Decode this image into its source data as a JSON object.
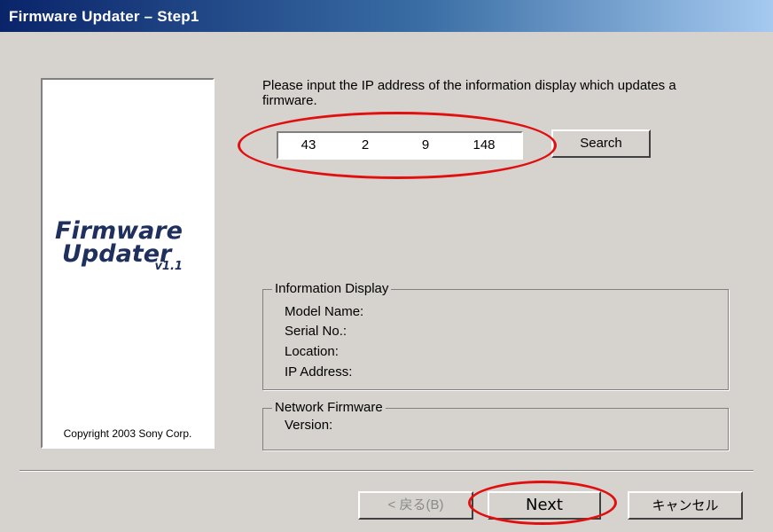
{
  "window": {
    "title": "Firmware Updater  –  Step1"
  },
  "logo": {
    "line1": "Firmware",
    "line2": "Updater",
    "version": "v1.1",
    "copyright": "Copyright 2003 Sony Corp."
  },
  "prompt": {
    "text": "Please input the IP address of the information display which updates a firmware."
  },
  "ip_address": {
    "octet1": "43",
    "octet2": "2",
    "octet3": "9",
    "octet4": "148"
  },
  "buttons": {
    "search": "Search",
    "back": "< 戻る(B)",
    "next": "Next",
    "cancel": "キャンセル"
  },
  "info_display": {
    "title": "Information Display",
    "model_name": "Model Name:",
    "serial_no": "Serial No.:",
    "location": "Location:",
    "ip_address": "IP Address:"
  },
  "network_firmware": {
    "title": "Network Firmware",
    "version": "Version:"
  },
  "colors": {
    "window_bg": "#d6d3ce",
    "titlebar_start": "#0a246a",
    "titlebar_end": "#a6caf0",
    "annotation": "#e01010"
  }
}
